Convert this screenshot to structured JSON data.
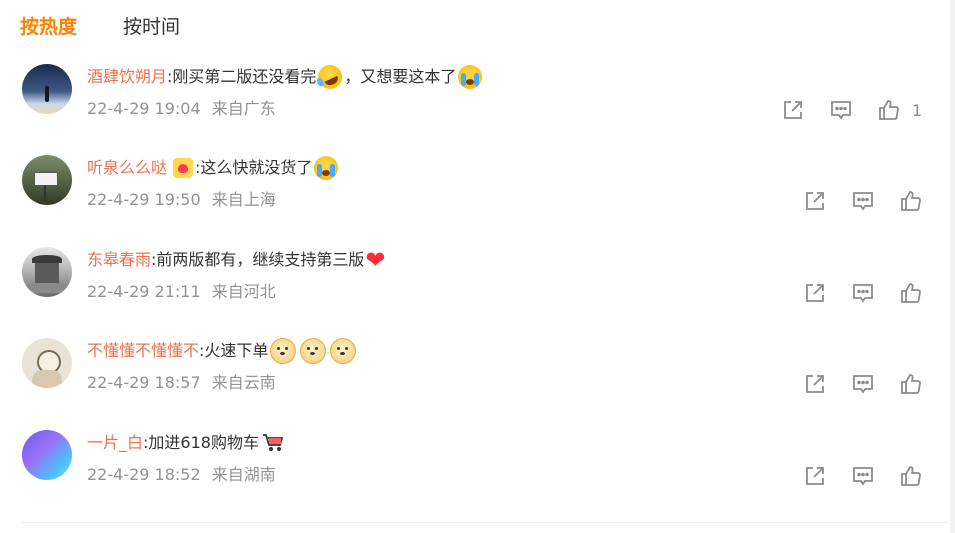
{
  "tabs": [
    {
      "label": "按热度",
      "active": true
    },
    {
      "label": "按时间",
      "active": false
    }
  ],
  "colors": {
    "accent": "#ff8200",
    "username": "#eb7350",
    "meta": "#939393",
    "icon": "#8c8c8c"
  },
  "comments": [
    {
      "username": "酒肆饮朔月",
      "text_before": ":刚买第二版还没看完",
      "text_after": "，又想要这本了",
      "emojis": [
        "laughing-tears-emoji",
        "crying-emoji"
      ],
      "time": "22-4-29 19:04",
      "location": "来自广东",
      "like_count": "1"
    },
    {
      "username": "听泉么么哒",
      "badge": "crown-heart-badge",
      "text_before": ":这么快就没货了",
      "emojis": [
        "crying-emoji"
      ],
      "time": "22-4-29 19:50",
      "location": "来自上海",
      "like_count": ""
    },
    {
      "username": "东皋春雨",
      "text_before": ":前两版都有，继续支持第三版",
      "emojis": [
        "red-heart-emoji"
      ],
      "time": "22-4-29 21:11",
      "location": "来自河北",
      "like_count": ""
    },
    {
      "username": "不懂懂不懂懂不",
      "text_before": ":火速下单",
      "emojis": [
        "doge-emoji",
        "doge-emoji",
        "doge-emoji"
      ],
      "time": "22-4-29 18:57",
      "location": "来自云南",
      "like_count": ""
    },
    {
      "username": "一片_白",
      "text_before": ":加进618购物车",
      "emojis": [
        "shopping-cart-emoji"
      ],
      "time": "22-4-29 18:52",
      "location": "来自湖南",
      "like_count": ""
    }
  ]
}
